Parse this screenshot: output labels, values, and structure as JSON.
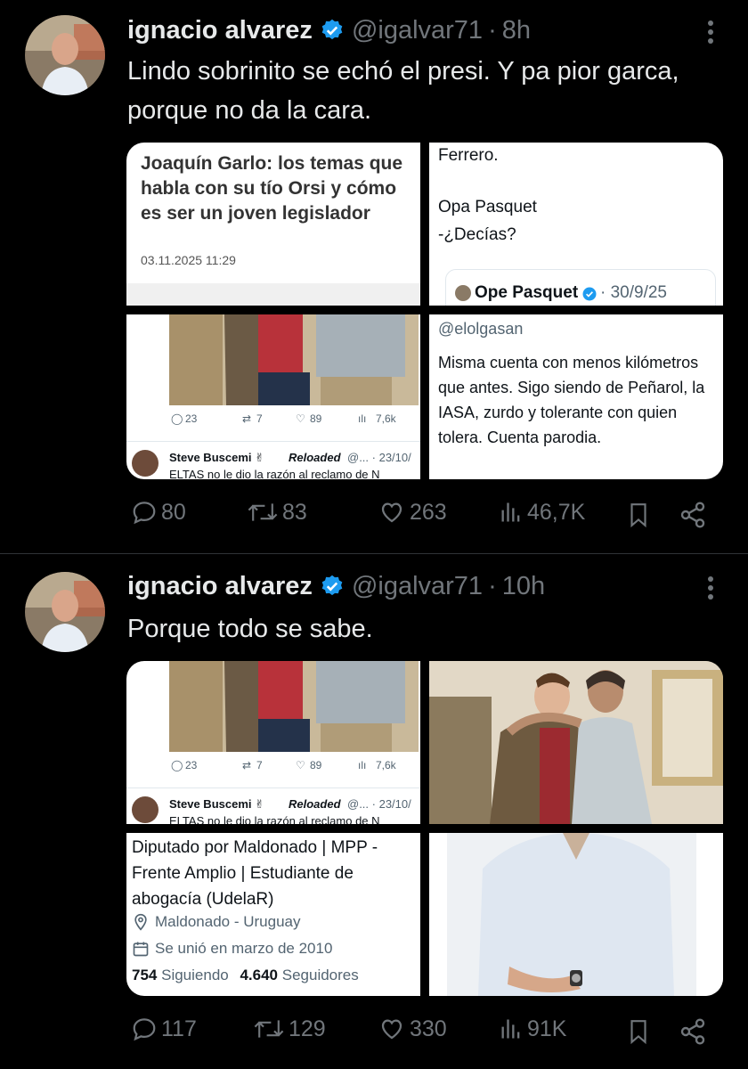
{
  "posts": [
    {
      "author": {
        "name": "ignacio alvarez",
        "handle": "@igalvar71",
        "time": "8h"
      },
      "text": "Lindo sobrinito se echó el presi. Y pa pior garca, porque no da la cara.",
      "media": {
        "article": {
          "headline": "Joaquín Garlo: los temas que habla con su tío Orsi y cómo es ser un joven legislador",
          "date": "03.11.2025 11:29"
        },
        "tweet_top": {
          "line1": "Ferrero.",
          "line2": "Opa Pasquet",
          "line3": "-¿Decías?",
          "quote_name": "Ope Pasquet",
          "quote_date": "· 30/9/25"
        },
        "photo_tweet": {
          "replies": "23",
          "retweets": "7",
          "likes": "89",
          "views": "7,6k",
          "reply_name": "Steve Buscemi ✌",
          "reply_tag": "Reloaded",
          "reply_handle": "@... · 23/10/",
          "reply_text": "ELTAS no le dio la razón al reclamo de N"
        },
        "bio": {
          "handle": "@elolgasan",
          "text": "Misma cuenta con menos kilómetros que antes. Sigo siendo de Peñarol, la IASA, zurdo y tolerante con quien tolera. Cuenta parodia."
        }
      },
      "stats": {
        "replies": "80",
        "reposts": "83",
        "likes": "263",
        "views": "46,7K"
      }
    },
    {
      "author": {
        "name": "ignacio alvarez",
        "handle": "@igalvar71",
        "time": "10h"
      },
      "text": "Porque todo se sabe.",
      "media": {
        "photo_tweet": {
          "replies": "23",
          "retweets": "7",
          "likes": "89",
          "views": "7,6k",
          "reply_name": "Steve Buscemi ✌",
          "reply_tag": "Reloaded",
          "reply_handle": "@... · 23/10/",
          "reply_text": "ELTAS no le dio la razón al reclamo de N"
        },
        "profile": {
          "bio": "Diputado por Maldonado | MPP - Frente Amplio | Estudiante de abogacía (UdelaR)",
          "location": "Maldonado - Uruguay",
          "joined": "Se unió en marzo de 2010",
          "following_count": "754",
          "following_label": "Siguiendo",
          "followers_count": "4.640",
          "followers_label": "Seguidores"
        }
      },
      "stats": {
        "replies": "117",
        "reposts": "129",
        "likes": "330",
        "views": "91K"
      }
    }
  ],
  "colors": {
    "background": "#000000",
    "text": "#e7e9ea",
    "muted": "#71767b",
    "verified": "#1d9bf0",
    "divider": "#2f3336"
  },
  "icons": [
    "verified-badge-icon",
    "more-icon",
    "reply-icon",
    "repost-icon",
    "like-icon",
    "views-icon",
    "bookmark-icon",
    "share-icon"
  ]
}
